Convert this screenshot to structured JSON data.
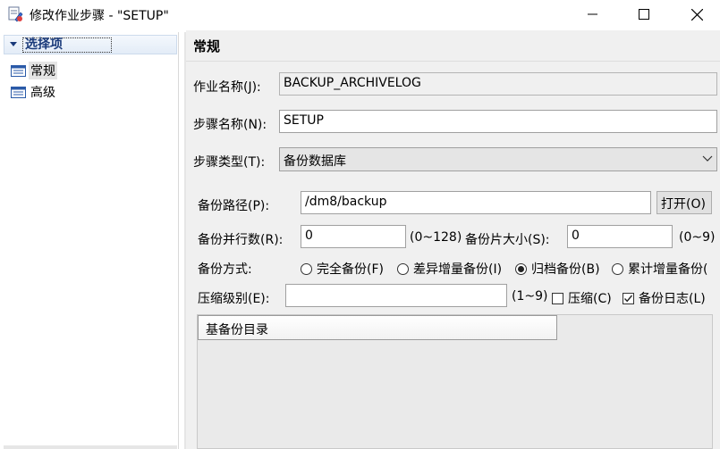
{
  "window": {
    "title": "修改作业步骤 - \"SETUP\"",
    "icons": {
      "app": "edit-step-icon",
      "minimize": "minimize-icon",
      "maximize": "maximize-icon",
      "close": "close-icon"
    }
  },
  "sidebar": {
    "header": "选择项",
    "items": [
      {
        "label": "常规",
        "icon": "page-icon",
        "selected": true
      },
      {
        "label": "高级",
        "icon": "page-icon",
        "selected": false
      }
    ]
  },
  "general": {
    "section_title": "常规",
    "job_name": {
      "label": "作业名称(J):",
      "value": "BACKUP_ARCHIVELOG"
    },
    "step_name": {
      "label": "步骤名称(N):",
      "value": "SETUP"
    },
    "step_type": {
      "label": "步骤类型(T):",
      "value": "备份数据库"
    },
    "backup_path": {
      "label": "备份路径(P):",
      "value": "/dm8/backup",
      "button": "打开(O)"
    },
    "parallel": {
      "label": "备份并行数(R):",
      "value": "0",
      "range": "(0~128)"
    },
    "piece_size": {
      "label": "备份片大小(S):",
      "value": "0",
      "range": "(0~9)"
    },
    "backup_mode": {
      "label": "备份方式:",
      "options": [
        {
          "label": "完全备份(F)",
          "selected": false
        },
        {
          "label": "差异增量备份(I)",
          "selected": false
        },
        {
          "label": "归档备份(B)",
          "selected": true
        },
        {
          "label": "累计增量备份(",
          "selected": false
        }
      ]
    },
    "compress_level": {
      "label": "压缩级别(E):",
      "value": "",
      "range": "(1~9)"
    },
    "compress": {
      "label": "压缩(C)",
      "checked": false
    },
    "backup_log": {
      "label": "备份日志(L)",
      "checked": true
    },
    "base_dir_table": {
      "column": "基备份目录"
    }
  },
  "colors": {
    "accent": "#1a3a7a",
    "panel_bg": "#f0f0f0"
  }
}
